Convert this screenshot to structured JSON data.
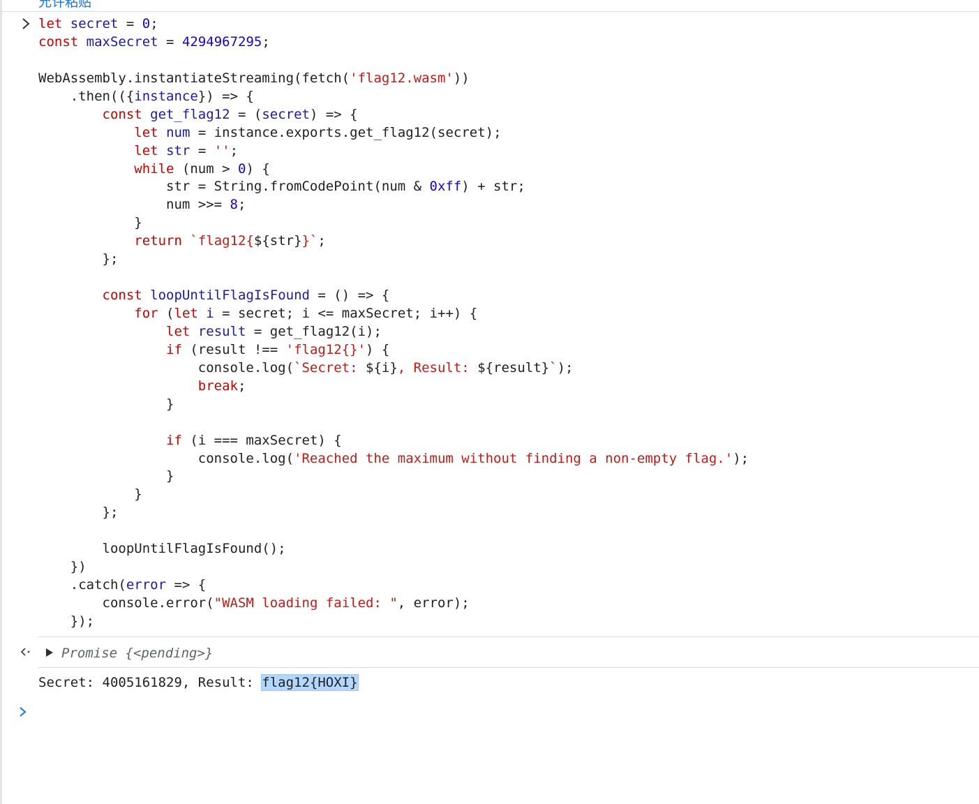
{
  "header": {
    "clipped_text": "允许粘贴"
  },
  "console": {
    "input_lines": [
      [
        {
          "t": "kw",
          "v": "let"
        },
        {
          "t": "op",
          "v": " "
        },
        {
          "t": "id",
          "v": "secret"
        },
        {
          "t": "op",
          "v": " = "
        },
        {
          "t": "num",
          "v": "0"
        },
        {
          "t": "op",
          "v": ";"
        }
      ],
      [
        {
          "t": "kw",
          "v": "const"
        },
        {
          "t": "op",
          "v": " "
        },
        {
          "t": "id",
          "v": "maxSecret"
        },
        {
          "t": "op",
          "v": " = "
        },
        {
          "t": "num",
          "v": "4294967295"
        },
        {
          "t": "op",
          "v": ";"
        }
      ],
      [],
      [
        {
          "t": "op",
          "v": "WebAssembly.instantiateStreaming(fetch("
        },
        {
          "t": "str",
          "v": "'flag12.wasm'"
        },
        {
          "t": "op",
          "v": "))"
        }
      ],
      [
        {
          "t": "op",
          "v": "    .then(({"
        },
        {
          "t": "id",
          "v": "instance"
        },
        {
          "t": "op",
          "v": "}) => {"
        }
      ],
      [
        {
          "t": "op",
          "v": "        "
        },
        {
          "t": "kw",
          "v": "const"
        },
        {
          "t": "op",
          "v": " "
        },
        {
          "t": "id",
          "v": "get_flag12"
        },
        {
          "t": "op",
          "v": " = ("
        },
        {
          "t": "id",
          "v": "secret"
        },
        {
          "t": "op",
          "v": ") => {"
        }
      ],
      [
        {
          "t": "op",
          "v": "            "
        },
        {
          "t": "kw",
          "v": "let"
        },
        {
          "t": "op",
          "v": " "
        },
        {
          "t": "id",
          "v": "num"
        },
        {
          "t": "op",
          "v": " = instance.exports.get_flag12(secret);"
        }
      ],
      [
        {
          "t": "op",
          "v": "            "
        },
        {
          "t": "kw",
          "v": "let"
        },
        {
          "t": "op",
          "v": " "
        },
        {
          "t": "id",
          "v": "str"
        },
        {
          "t": "op",
          "v": " = "
        },
        {
          "t": "str",
          "v": "''"
        },
        {
          "t": "op",
          "v": ";"
        }
      ],
      [
        {
          "t": "op",
          "v": "            "
        },
        {
          "t": "kw",
          "v": "while"
        },
        {
          "t": "op",
          "v": " (num > "
        },
        {
          "t": "num",
          "v": "0"
        },
        {
          "t": "op",
          "v": ") {"
        }
      ],
      [
        {
          "t": "op",
          "v": "                str = String.fromCodePoint(num & "
        },
        {
          "t": "num",
          "v": "0xff"
        },
        {
          "t": "op",
          "v": ") + str;"
        }
      ],
      [
        {
          "t": "op",
          "v": "                num >>= "
        },
        {
          "t": "num",
          "v": "8"
        },
        {
          "t": "op",
          "v": ";"
        }
      ],
      [
        {
          "t": "op",
          "v": "            }"
        }
      ],
      [
        {
          "t": "op",
          "v": "            "
        },
        {
          "t": "kw",
          "v": "return"
        },
        {
          "t": "op",
          "v": " "
        },
        {
          "t": "str",
          "v": "`flag12{"
        },
        {
          "t": "op",
          "v": "${str}"
        },
        {
          "t": "str",
          "v": "}`"
        },
        {
          "t": "op",
          "v": ";"
        }
      ],
      [
        {
          "t": "op",
          "v": "        };"
        }
      ],
      [],
      [
        {
          "t": "op",
          "v": "        "
        },
        {
          "t": "kw",
          "v": "const"
        },
        {
          "t": "op",
          "v": " "
        },
        {
          "t": "id",
          "v": "loopUntilFlagIsFound"
        },
        {
          "t": "op",
          "v": " = () => {"
        }
      ],
      [
        {
          "t": "op",
          "v": "            "
        },
        {
          "t": "kw",
          "v": "for"
        },
        {
          "t": "op",
          "v": " ("
        },
        {
          "t": "kw",
          "v": "let"
        },
        {
          "t": "op",
          "v": " "
        },
        {
          "t": "id",
          "v": "i"
        },
        {
          "t": "op",
          "v": " = secret; i <= maxSecret; i++) {"
        }
      ],
      [
        {
          "t": "op",
          "v": "                "
        },
        {
          "t": "kw",
          "v": "let"
        },
        {
          "t": "op",
          "v": " "
        },
        {
          "t": "id",
          "v": "result"
        },
        {
          "t": "op",
          "v": " = get_flag12(i);"
        }
      ],
      [
        {
          "t": "op",
          "v": "                "
        },
        {
          "t": "kw",
          "v": "if"
        },
        {
          "t": "op",
          "v": " (result !== "
        },
        {
          "t": "str",
          "v": "'flag12{}'"
        },
        {
          "t": "op",
          "v": ") {"
        }
      ],
      [
        {
          "t": "op",
          "v": "                    console.log("
        },
        {
          "t": "str",
          "v": "`Secret: "
        },
        {
          "t": "op",
          "v": "${i}"
        },
        {
          "t": "str",
          "v": ", Result: "
        },
        {
          "t": "op",
          "v": "${result}"
        },
        {
          "t": "str",
          "v": "`"
        },
        {
          "t": "op",
          "v": ");"
        }
      ],
      [
        {
          "t": "op",
          "v": "                    "
        },
        {
          "t": "kw",
          "v": "break"
        },
        {
          "t": "op",
          "v": ";"
        }
      ],
      [
        {
          "t": "op",
          "v": "                }"
        }
      ],
      [],
      [
        {
          "t": "op",
          "v": "                "
        },
        {
          "t": "kw",
          "v": "if"
        },
        {
          "t": "op",
          "v": " (i === maxSecret) {"
        }
      ],
      [
        {
          "t": "op",
          "v": "                    console.log("
        },
        {
          "t": "str",
          "v": "'Reached the maximum without finding a non-empty flag.'"
        },
        {
          "t": "op",
          "v": ");"
        }
      ],
      [
        {
          "t": "op",
          "v": "                }"
        }
      ],
      [
        {
          "t": "op",
          "v": "            }"
        }
      ],
      [
        {
          "t": "op",
          "v": "        };"
        }
      ],
      [],
      [
        {
          "t": "op",
          "v": "        loopUntilFlagIsFound();"
        }
      ],
      [
        {
          "t": "op",
          "v": "    })"
        }
      ],
      [
        {
          "t": "op",
          "v": "    .catch("
        },
        {
          "t": "id",
          "v": "error"
        },
        {
          "t": "op",
          "v": " => {"
        }
      ],
      [
        {
          "t": "op",
          "v": "        console.error("
        },
        {
          "t": "str",
          "v": "\"WASM loading failed: \""
        },
        {
          "t": "op",
          "v": ", error);"
        }
      ],
      [
        {
          "t": "op",
          "v": "    });"
        }
      ]
    ],
    "return_value": "Promise {<pending>}",
    "log_prefix": "Secret: 4005161829, Result: ",
    "log_highlight": "flag12{HOXI}"
  },
  "colors": {
    "keyword": "#c80000",
    "identifier": "#1a1aa6",
    "string": "#c41a16",
    "number": "#1c00cf",
    "prompt": "#1a73e8",
    "highlight": "#b3d7ff"
  },
  "icons": {
    "input_prompt": "chevron-right-icon",
    "return_marker": "return-arrow-icon",
    "expand": "triangle-right-icon",
    "next_prompt": "chevron-right-icon"
  }
}
